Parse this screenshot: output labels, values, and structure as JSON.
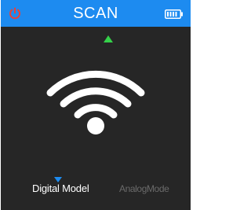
{
  "header": {
    "title": "SCAN",
    "power_icon": "power-icon",
    "battery_icon": "battery-icon"
  },
  "main": {
    "status_icon": "wifi-signal-icon"
  },
  "modes": {
    "items": [
      {
        "label": "Digital Model",
        "selected": true
      },
      {
        "label": "AnalogMode",
        "selected": false
      }
    ]
  },
  "colors": {
    "header_bg": "#1d8bf0",
    "screen_bg": "#262626",
    "power": "#e8413a",
    "indicator_green": "#35d14a",
    "indicator_blue": "#1d8bf0",
    "text_active": "#ffffff",
    "text_inactive": "#6a6a6a"
  }
}
